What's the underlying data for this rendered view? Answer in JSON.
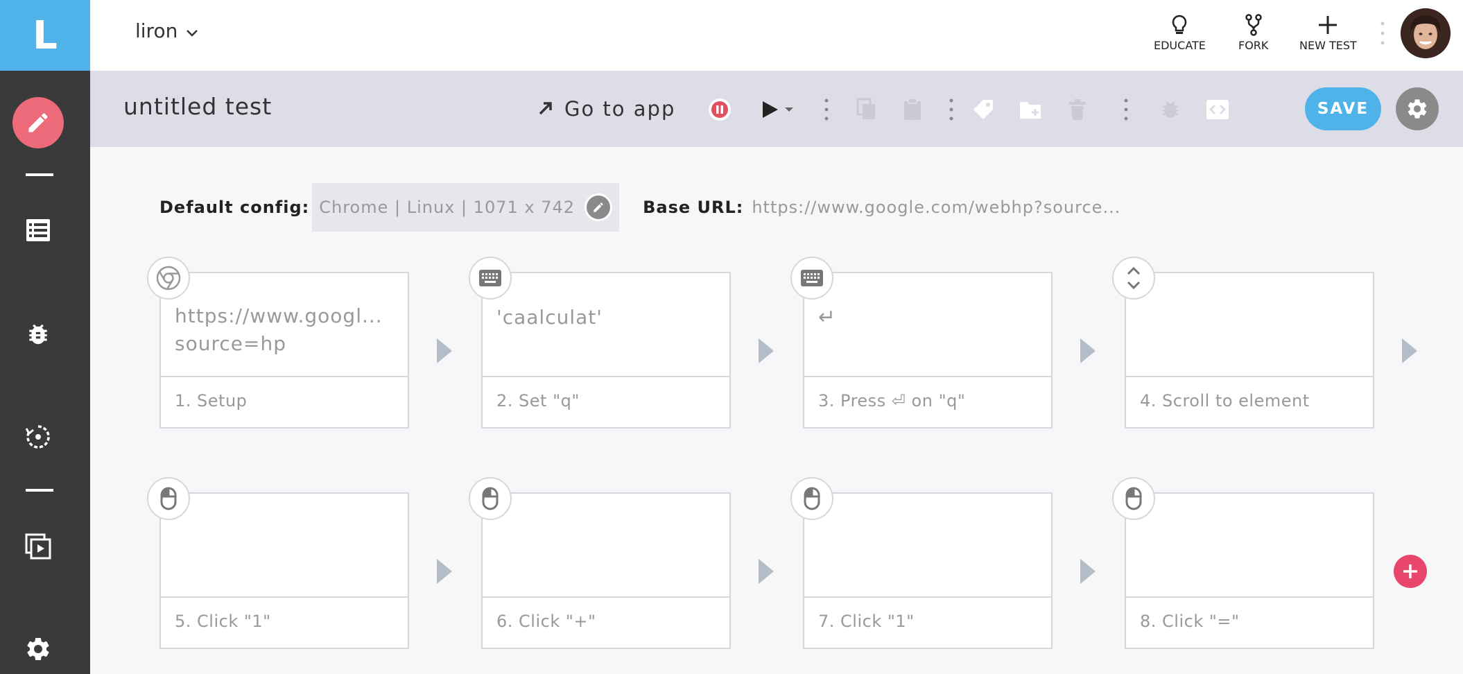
{
  "sidebar": {
    "logo": "L",
    "items": [
      {
        "name": "edit",
        "icon": "pencil-icon"
      },
      {
        "name": "tests",
        "icon": "list-icon"
      },
      {
        "name": "bugs",
        "icon": "bug-icon"
      },
      {
        "name": "runs",
        "icon": "refresh-icon"
      },
      {
        "name": "suites",
        "icon": "play-stack-icon"
      },
      {
        "name": "settings",
        "icon": "gear-icon"
      }
    ]
  },
  "header": {
    "project": "liron",
    "actions": [
      {
        "label": "EDUCATE",
        "icon": "lightbulb-icon"
      },
      {
        "label": "FORK",
        "icon": "fork-icon"
      },
      {
        "label": "NEW TEST",
        "icon": "plus-icon"
      }
    ]
  },
  "toolbar": {
    "title": "untitled test",
    "goto_app": "Go to app",
    "save_label": "SAVE"
  },
  "config": {
    "default_label": "Default config:",
    "default_value": "Chrome | Linux | 1071 x 742",
    "base_label": "Base URL:",
    "base_value": "https://www.google.com/webhp?source..."
  },
  "steps": [
    {
      "body": "https://www.googl... source=hp",
      "label": "1. Setup",
      "icon": "chrome-icon"
    },
    {
      "body": "'caalculat'",
      "label": "2. Set \"q\"",
      "icon": "keyboard-icon"
    },
    {
      "body": "↵",
      "label": "3. Press ⏎ on \"q\"",
      "icon": "keyboard-icon"
    },
    {
      "body": "",
      "label": "4. Scroll to element",
      "icon": "scroll-icon"
    },
    {
      "body": "",
      "label": "5. Click \"1\"",
      "icon": "mouse-icon"
    },
    {
      "body": "",
      "label": "6. Click \"+\"",
      "icon": "mouse-icon"
    },
    {
      "body": "",
      "label": "7. Click \"1\"",
      "icon": "mouse-icon"
    },
    {
      "body": "",
      "label": "8. Click \"=\"",
      "icon": "mouse-icon"
    }
  ],
  "colors": {
    "accent_blue": "#4fb3ea",
    "accent_pink": "#ec6a7a",
    "add_pink": "#e8466a",
    "sidebar_bg": "#3a3a3a",
    "toolbar_bg": "#dcdde6"
  }
}
